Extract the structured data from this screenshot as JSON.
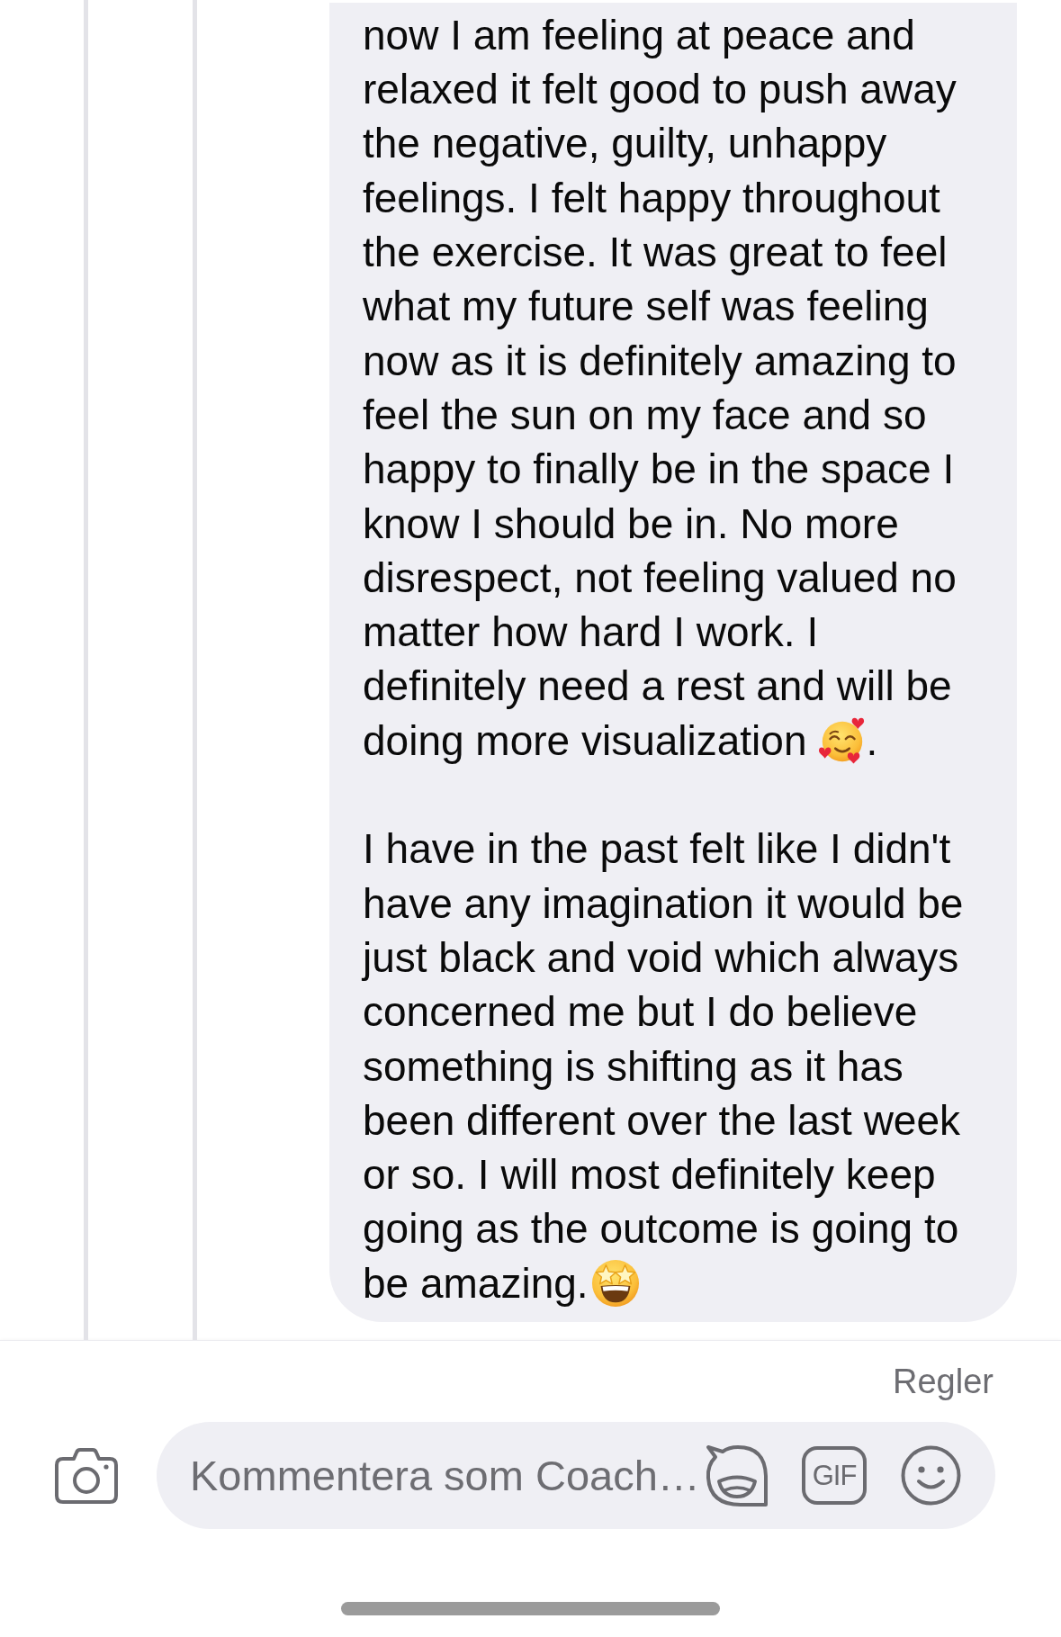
{
  "thread": {
    "message": {
      "paragraphs": [
        {
          "parts": [
            {
              "kind": "text",
              "text": "now I am feeling at peace and\nrelaxed it felt good to push away\nthe negative, guilty, unhappy\nfeelings. I felt happy throughout\nthe exercise. It was great to feel\nwhat my future self was feeling\nnow as it is definitely amazing to\nfeel the sun on my face and so\nhappy to finally be in the space I\nknow I should be in. No more\ndisrespect, not feeling valued no\nmatter how hard I work. I\ndefinitely need a rest and will be\ndoing more visualization"
            },
            {
              "kind": "hearts_face_emoji"
            },
            {
              "kind": "text",
              "text": "."
            }
          ]
        },
        {
          "parts": [
            {
              "kind": "text",
              "text": "I have in the past felt like I didn't\nhave any imagination it would be\njust black and void which always\nconcerned me but I do believe\nsomething is shifting as it has\nbeen different over the last week\nor so. I will most definitely keep\ngoing as the outcome is going to\nbe amazing."
            },
            {
              "kind": "star_face_emoji"
            }
          ]
        }
      ]
    }
  },
  "composer": {
    "rules_link": "Regler",
    "placeholder": "Kommentera som Coach…",
    "gif_label": "GIF"
  }
}
